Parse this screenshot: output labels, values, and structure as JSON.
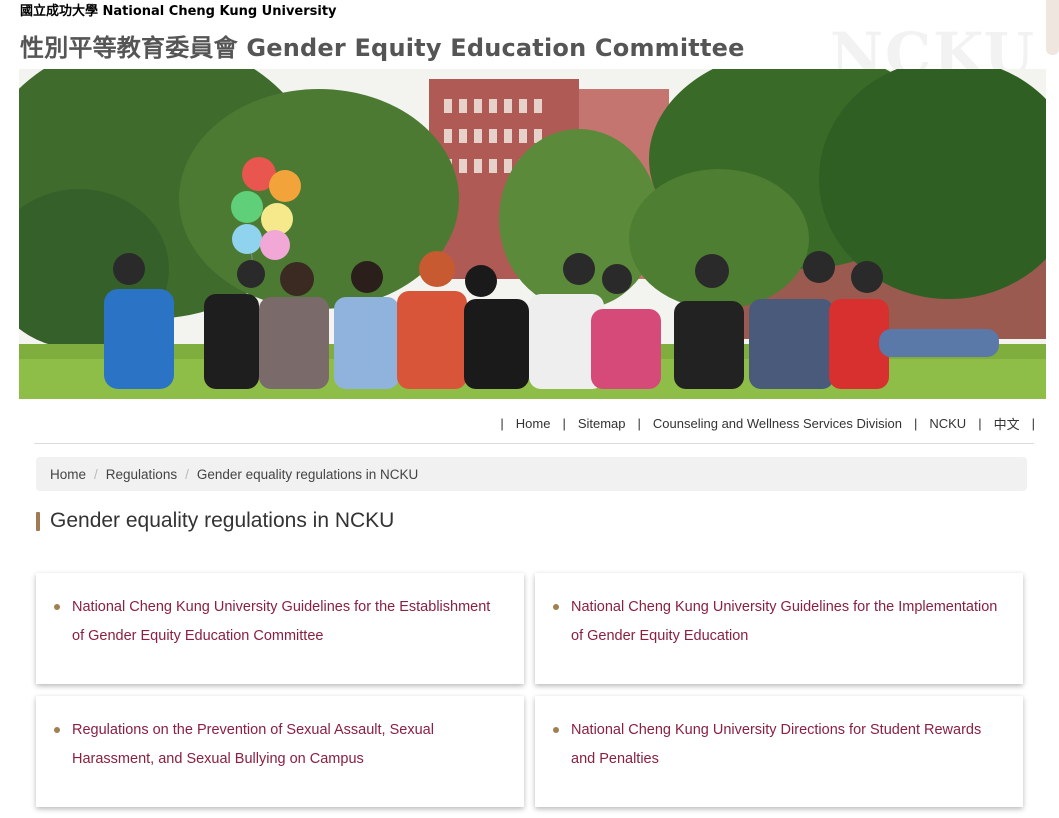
{
  "header": {
    "university": "國立成功大學 National Cheng Kung University",
    "site_title": "性別平等教育委員會 Gender Equity Education Committee",
    "watermark": "NCKU"
  },
  "banner": {
    "alt": "banner-photo"
  },
  "topnav": {
    "items": [
      "Home",
      "Sitemap",
      "Counseling and Wellness Services Division",
      "NCKU",
      "中文"
    ]
  },
  "breadcrumb": {
    "items": [
      "Home",
      "Regulations",
      "Gender equality regulations in NCKU"
    ]
  },
  "page": {
    "title": "Gender equality regulations in NCKU"
  },
  "cards": [
    {
      "label": "National Cheng Kung University Guidelines for the Establishment of Gender Equity Education Committee"
    },
    {
      "label": "National Cheng Kung University Guidelines for the Implementation of Gender Equity Education"
    },
    {
      "label": "Regulations on the Prevention of Sexual Assault, Sexual Harassment, and Sexual Bullying on Campus"
    },
    {
      "label": "National Cheng Kung University Directions for Student Rewards and Penalties"
    }
  ],
  "colors": {
    "link": "#8a2040",
    "accent": "#a07a55",
    "breadcrumb_bg": "#f1f1f1"
  }
}
